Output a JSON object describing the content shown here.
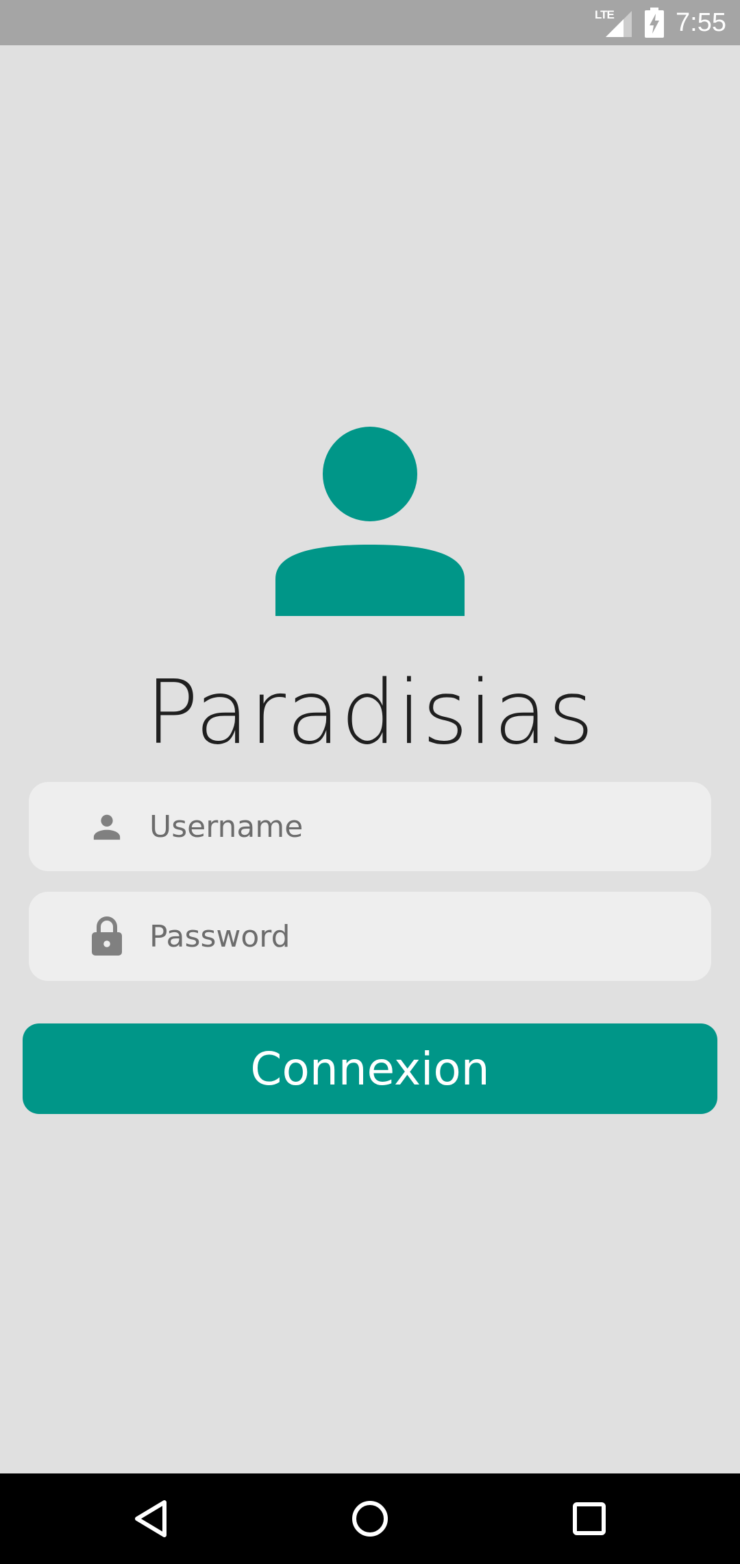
{
  "status_bar": {
    "network": "LTE",
    "time": "7:55"
  },
  "app": {
    "title": "Paradisias",
    "avatar_icon": "person-icon",
    "accent_color": "#009688"
  },
  "form": {
    "username": {
      "icon": "person-icon",
      "placeholder": "Username",
      "value": ""
    },
    "password": {
      "icon": "lock-icon",
      "placeholder": "Password",
      "value": ""
    },
    "submit_label": "Connexion"
  },
  "nav_bar": {
    "buttons": [
      "back-icon",
      "home-icon",
      "recents-icon"
    ]
  }
}
